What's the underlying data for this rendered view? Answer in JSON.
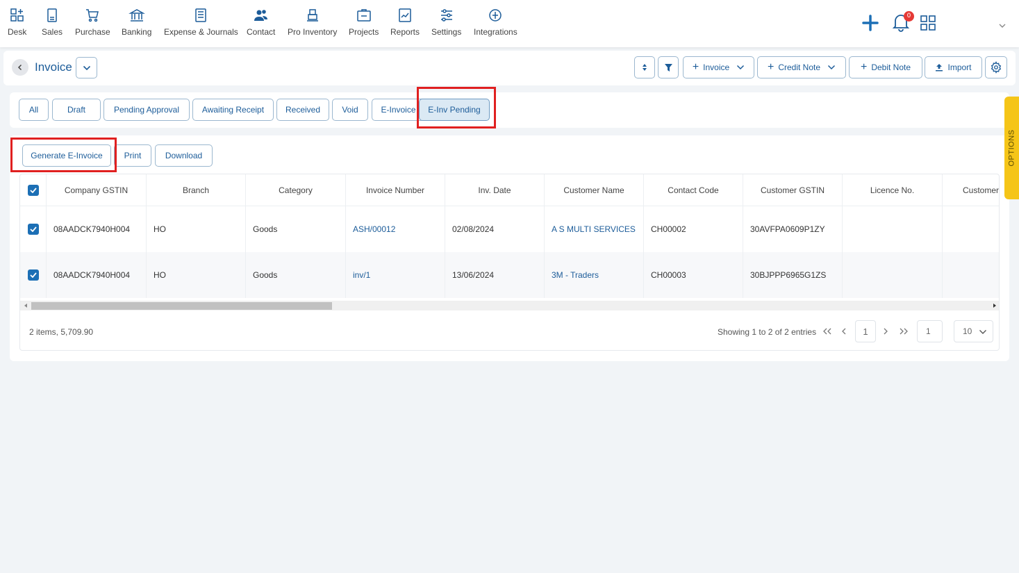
{
  "nav": {
    "items": [
      {
        "label": "Desk",
        "icon": "desk-icon"
      },
      {
        "label": "Sales",
        "icon": "sales-icon"
      },
      {
        "label": "Purchase",
        "icon": "cart-icon"
      },
      {
        "label": "Banking",
        "icon": "bank-icon"
      },
      {
        "label": "Expense & Journals",
        "icon": "journal-icon"
      },
      {
        "label": "Contact",
        "icon": "contact-icon"
      },
      {
        "label": "Pro Inventory",
        "icon": "inventory-icon"
      },
      {
        "label": "Projects",
        "icon": "projects-icon"
      },
      {
        "label": "Reports",
        "icon": "reports-icon"
      },
      {
        "label": "Settings",
        "icon": "settings-sliders-icon"
      },
      {
        "label": "Integrations",
        "icon": "integrations-icon"
      }
    ],
    "notification_count": "0"
  },
  "header": {
    "title": "Invoice",
    "buttons": {
      "invoice": "Invoice",
      "credit_note": "Credit Note",
      "debit_note": "Debit Note",
      "import": "Import"
    }
  },
  "tabs": [
    "All",
    "Draft",
    "Pending Approval",
    "Awaiting Receipt",
    "Received",
    "Void",
    "E-Invoice",
    "E-Inv Pending"
  ],
  "active_tab": "E-Inv Pending",
  "actions": {
    "generate": "Generate E-Invoice",
    "print": "Print",
    "download": "Download"
  },
  "table": {
    "columns": [
      "Company GSTIN",
      "Branch",
      "Category",
      "Invoice Number",
      "Inv. Date",
      "Customer Name",
      "Contact Code",
      "Customer GSTIN",
      "Licence No.",
      "Customer"
    ],
    "rows": [
      [
        "08AADCK7940H004",
        "HO",
        "Goods",
        "ASH/00012",
        "02/08/2024",
        "A S MULTI SERVICES",
        "CH00002",
        "30AVFPA0609P1ZY",
        "",
        ""
      ],
      [
        "08AADCK7940H004",
        "HO",
        "Goods",
        "inv/1",
        "13/06/2024",
        "3M - Traders",
        "CH00003",
        "30BJPPP6965G1ZS",
        "",
        ""
      ]
    ]
  },
  "footer": {
    "summary": "2 items, 5,709.90",
    "showing": "Showing 1 to 2 of 2 entries",
    "current_page": "1",
    "goto_page": "1",
    "page_size": "10"
  },
  "options_label": "OPTIONS",
  "colors": {
    "accent": "#1c5c99",
    "highlight": "#e02020",
    "options_tab": "#f5c518"
  }
}
